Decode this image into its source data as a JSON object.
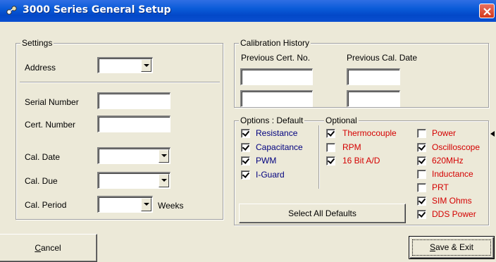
{
  "window": {
    "title": "3000 Series General Setup"
  },
  "settings": {
    "group_label": "Settings",
    "address_label": "Address",
    "address_value": "",
    "serial_label": "Serial Number",
    "serial_value": "",
    "cert_label": "Cert. Number",
    "cert_value": "",
    "cal_date_label": "Cal. Date",
    "cal_date_value": "",
    "cal_due_label": "Cal. Due",
    "cal_due_value": "",
    "cal_period_label": "Cal. Period",
    "cal_period_value": "",
    "weeks_label": "Weeks"
  },
  "calibration": {
    "group_label": "Calibration History",
    "prev_cert_label": "Previous Cert. No.",
    "prev_date_label": "Previous Cal. Date",
    "prev_cert_1": "",
    "prev_cert_2": "",
    "prev_date_1": "",
    "prev_date_2": ""
  },
  "options": {
    "default_label": "Options : Default",
    "optional_label": "Optional",
    "defaults": [
      {
        "label": "Resistance",
        "checked": true
      },
      {
        "label": "Capacitance",
        "checked": true
      },
      {
        "label": "PWM",
        "checked": true
      },
      {
        "label": "I-Guard",
        "checked": true
      }
    ],
    "optional_col1": [
      {
        "label": "Thermocouple",
        "checked": true
      },
      {
        "label": "RPM",
        "checked": false
      },
      {
        "label": "16 Bit A/D",
        "checked": true
      }
    ],
    "optional_col2": [
      {
        "label": "Power",
        "checked": false
      },
      {
        "label": "Oscilloscope",
        "checked": true
      },
      {
        "label": "620MHz",
        "checked": true
      },
      {
        "label": "Inductance",
        "checked": false
      },
      {
        "label": "PRT",
        "checked": false
      },
      {
        "label": "SIM Ohms",
        "checked": true
      },
      {
        "label": "DDS Power",
        "checked": true
      }
    ],
    "select_all_label": "Select All Defaults"
  },
  "buttons": {
    "cancel_mnemonic": "C",
    "cancel_rest": "ancel",
    "save_mnemonic": "S",
    "save_rest": "ave & Exit"
  },
  "colors": {
    "default_option": "#00007f",
    "optional_option": "#d40000",
    "titlebar": "#0a5bd8"
  }
}
